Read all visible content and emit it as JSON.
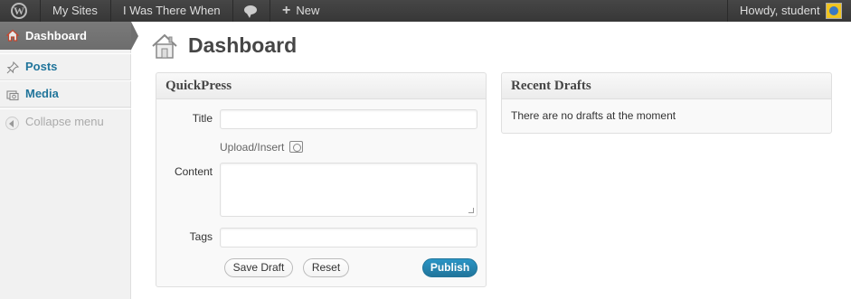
{
  "adminbar": {
    "logo_icon": "wordpress-logo-icon",
    "my_sites_label": "My Sites",
    "site_name_label": "I Was There When",
    "comments_icon": "comment-bubble-icon",
    "new_label": "New",
    "howdy_label": "Howdy, student",
    "avatar_icon": "user-avatar-icon"
  },
  "sidebar": {
    "items": [
      {
        "label": "Dashboard",
        "icon": "home-icon",
        "active": true
      },
      {
        "label": "Posts",
        "icon": "pushpin-icon"
      },
      {
        "label": "Media",
        "icon": "media-icon"
      }
    ],
    "collapse_label": "Collapse menu"
  },
  "page": {
    "title": "Dashboard",
    "icon": "dashboard-house-icon"
  },
  "quickpress": {
    "heading": "QuickPress",
    "title_label": "Title",
    "title_value": "",
    "upload_insert_label": "Upload/Insert",
    "content_label": "Content",
    "content_value": "",
    "tags_label": "Tags",
    "tags_value": "",
    "save_draft_label": "Save Draft",
    "reset_label": "Reset",
    "publish_label": "Publish"
  },
  "recent_drafts": {
    "heading": "Recent Drafts",
    "empty_text": "There are no drafts at the moment"
  },
  "colors": {
    "adminbar_bg": "#464646",
    "link_blue": "#21759b",
    "publish_button": "#2a95c5",
    "active_menu_bg": "#6d6d6d"
  }
}
